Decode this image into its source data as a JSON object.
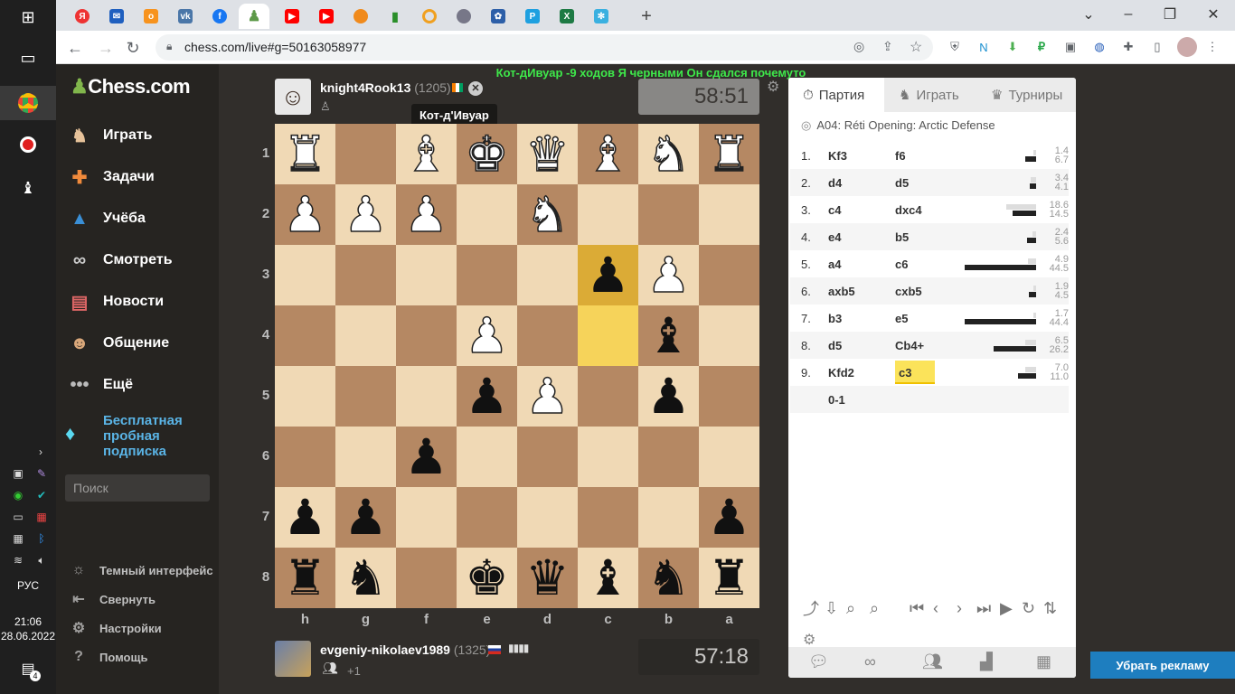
{
  "taskbar": {
    "language": "РУС",
    "time": "21:06",
    "date": "28.06.2022",
    "notifications": "4"
  },
  "browser": {
    "url": "chess.com/live#g=50163058977"
  },
  "sidebar": {
    "logo": "Chess.com",
    "items": [
      {
        "label": "Играть",
        "icon": "play-icon"
      },
      {
        "label": "Задачи",
        "icon": "puzzle-icon"
      },
      {
        "label": "Учёба",
        "icon": "learn-icon"
      },
      {
        "label": "Смотреть",
        "icon": "binoculars-icon"
      },
      {
        "label": "Новости",
        "icon": "news-icon"
      },
      {
        "label": "Общение",
        "icon": "social-icon"
      },
      {
        "label": "Ещё",
        "icon": "more-icon"
      }
    ],
    "promo": "Бесплатная пробная подписка",
    "search_placeholder": "Поиск",
    "footer": [
      {
        "label": "Темный интерфейс",
        "icon": "sun-icon"
      },
      {
        "label": "Свернуть",
        "icon": "collapse-icon"
      },
      {
        "label": "Настройки",
        "icon": "gear-icon"
      },
      {
        "label": "Помощь",
        "icon": "help-icon"
      }
    ]
  },
  "banner": "Кот-дИвуар -9 ходов Я черными Он сдался почемуто",
  "top_player": {
    "name": "knight4Rook13",
    "rating": "(1205)",
    "clock": "58:51"
  },
  "bottom_player": {
    "name": "evgeniy-nikolaev1989",
    "rating": "(1325)",
    "clock": "57:18",
    "extra": "+1"
  },
  "tooltip": "Кот-д'Ивуар",
  "board": {
    "ranks": [
      "1",
      "2",
      "3",
      "4",
      "5",
      "6",
      "7",
      "8"
    ],
    "files": [
      "h",
      "g",
      "f",
      "e",
      "d",
      "c",
      "b",
      "a"
    ],
    "rows": [
      [
        "wR",
        "",
        "wB",
        "wK",
        "wQ",
        "wB",
        "wN",
        "wR"
      ],
      [
        "wP",
        "wP",
        "wP",
        "",
        "wN",
        "",
        "",
        ""
      ],
      [
        "",
        "",
        "",
        "",
        "",
        "bP*",
        "wP",
        ""
      ],
      [
        "",
        "",
        "",
        "wP",
        "",
        "*",
        "bB",
        ""
      ],
      [
        "",
        "",
        "",
        "bP",
        "wP",
        "",
        "bP",
        ""
      ],
      [
        "",
        "",
        "bP",
        "",
        "",
        "",
        "",
        ""
      ],
      [
        "bP",
        "bP",
        "",
        "",
        "",
        "",
        "",
        "bP"
      ],
      [
        "bR",
        "bN",
        "",
        "bK",
        "bQ",
        "bB",
        "bN",
        "bR"
      ]
    ]
  },
  "panel": {
    "tabs": [
      "Партия",
      "Играть",
      "Турниры"
    ],
    "opening": "A04: Réti Opening: Arctic Defense",
    "moves": [
      {
        "n": "1.",
        "w": "Kf3",
        "b": "f6",
        "tw": "1.4",
        "tb": "6.7"
      },
      {
        "n": "2.",
        "w": "d4",
        "b": "d5",
        "tw": "3.4",
        "tb": "4.1"
      },
      {
        "n": "3.",
        "w": "c4",
        "b": "dxc4",
        "tw": "18.6",
        "tb": "14.5"
      },
      {
        "n": "4.",
        "w": "e4",
        "b": "b5",
        "tw": "2.4",
        "tb": "5.6"
      },
      {
        "n": "5.",
        "w": "a4",
        "b": "c6",
        "tw": "4.9",
        "tb": "44.5"
      },
      {
        "n": "6.",
        "w": "axb5",
        "b": "cxb5",
        "tw": "1.9",
        "tb": "4.5"
      },
      {
        "n": "7.",
        "w": "b3",
        "b": "e5",
        "tw": "1.7",
        "tb": "44.4"
      },
      {
        "n": "8.",
        "w": "d5",
        "b": "Cb4+",
        "tw": "6.5",
        "tb": "26.2"
      },
      {
        "n": "9.",
        "w": "Kfd2",
        "b": "c3",
        "tw": "7.0",
        "tb": "11.0"
      }
    ],
    "result": "0-1"
  },
  "remove_ads": "Убрать рекламу",
  "colors": {
    "accent": "#81b64c",
    "light_square": "#f0d9b5",
    "dark_square": "#b58863",
    "banner": "#3ee84a"
  }
}
